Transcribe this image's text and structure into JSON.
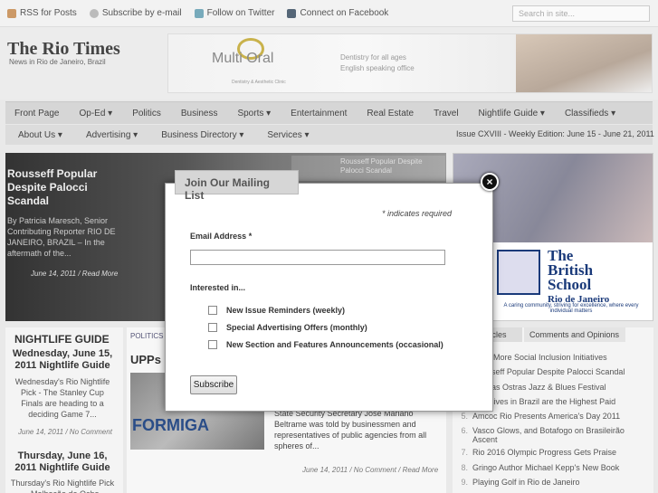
{
  "topbar": {
    "links": [
      {
        "label": "RSS for Posts",
        "icon": "rss-icon"
      },
      {
        "label": "Subscribe by e-mail",
        "icon": "mail-icon"
      },
      {
        "label": "Follow on Twitter",
        "icon": "twitter-icon"
      },
      {
        "label": "Connect on Facebook",
        "icon": "facebook-icon"
      }
    ],
    "search_placeholder": "Search in site..."
  },
  "header": {
    "title": "The Rio Times",
    "tagline": "News in Rio de Janeiro, Brazil",
    "ad": {
      "brand": "Multi Oral",
      "brand_sub": "Dentistry & Aesthetic Clinic",
      "line1": "Dentistry for all ages",
      "line2": "English speaking office"
    }
  },
  "nav_primary": [
    "Front Page",
    "Op-Ed ▾",
    "Politics",
    "Business",
    "Sports ▾",
    "Entertainment",
    "Real Estate",
    "Travel",
    "Nightlife Guide ▾",
    "Classifieds ▾"
  ],
  "nav_secondary": [
    "About Us ▾",
    "Advertising ▾",
    "Business Directory ▾",
    "Services ▾"
  ],
  "issue": "Issue CXVIII - Weekly Edition: June 15 - June 21, 2011",
  "featured": {
    "title": "Rousseff Popular Despite Palocci Scandal",
    "byline": "By Patricia Maresch, Senior Contributing Reporter RIO DE JANEIRO, BRAZIL – In the aftermath of the...",
    "date": "June 14, 2011 / Read More",
    "thumb_title": "Rousseff Popular Despite Palocci Scandal"
  },
  "school_ad": {
    "name_line1": "The",
    "name_line2": "British",
    "name_line3": "School",
    "name_line4": "Rio de Janeiro",
    "tagline": "A caring community, striving for excellence, where every individual matters"
  },
  "nightlife": {
    "heading": "NIGHTLIFE GUIDE",
    "post1_title": "Wednesday, June 15, 2011 Nightlife Guide",
    "post1_text": "Wednesday's Rio Nightlife Pick - The Stanley Cup Finals are heading to a deciding Game 7...",
    "post1_date": "June 14, 2011 / No Comment",
    "post2_title": "Thursday, June 16, 2011 Nightlife Guide",
    "post2_text": "Thursday's Rio Nightlife Pick - Malhação de Ocho"
  },
  "middle": {
    "category": "POLITICS",
    "title": "UPPs",
    "image_text": "FORMIGA",
    "excerpt": "State Security Secretary José Mariano Beltrame was told by businessmen and representatives of public agencies from all spheres of...",
    "date": "June 14, 2011 / No Comment / Read More"
  },
  "right": {
    "tab1": "Articles",
    "tab2": "Comments and Opinions",
    "items": [
      "Seek More Social Inclusion Initiatives",
      "Rousseff Popular Despite Palocci Scandal",
      "Rio das Ostras Jazz & Blues Festival",
      "Inclusives in Brazil are the Highest Paid",
      "Amcoc Rio Presents America's Day 2011",
      "Vasco Glows, and Botafogo on Brasileirão Ascent",
      "Rio 2016 Olympic Progress Gets Praise",
      "Gringo Author Michael Kepp's New Book",
      "Playing Golf in Rio de Janeiro"
    ]
  },
  "modal": {
    "tab_title": "Join Our Mailing List",
    "close": "×",
    "required_note": "* indicates required",
    "email_label": "Email Address *",
    "email_value": "",
    "interest_label": "Interested in...",
    "options": [
      "New Issue Reminders (weekly)",
      "Special Advertising Offers (monthly)",
      "New Section and Features Announcements (occasional)"
    ],
    "submit": "Subscribe"
  }
}
